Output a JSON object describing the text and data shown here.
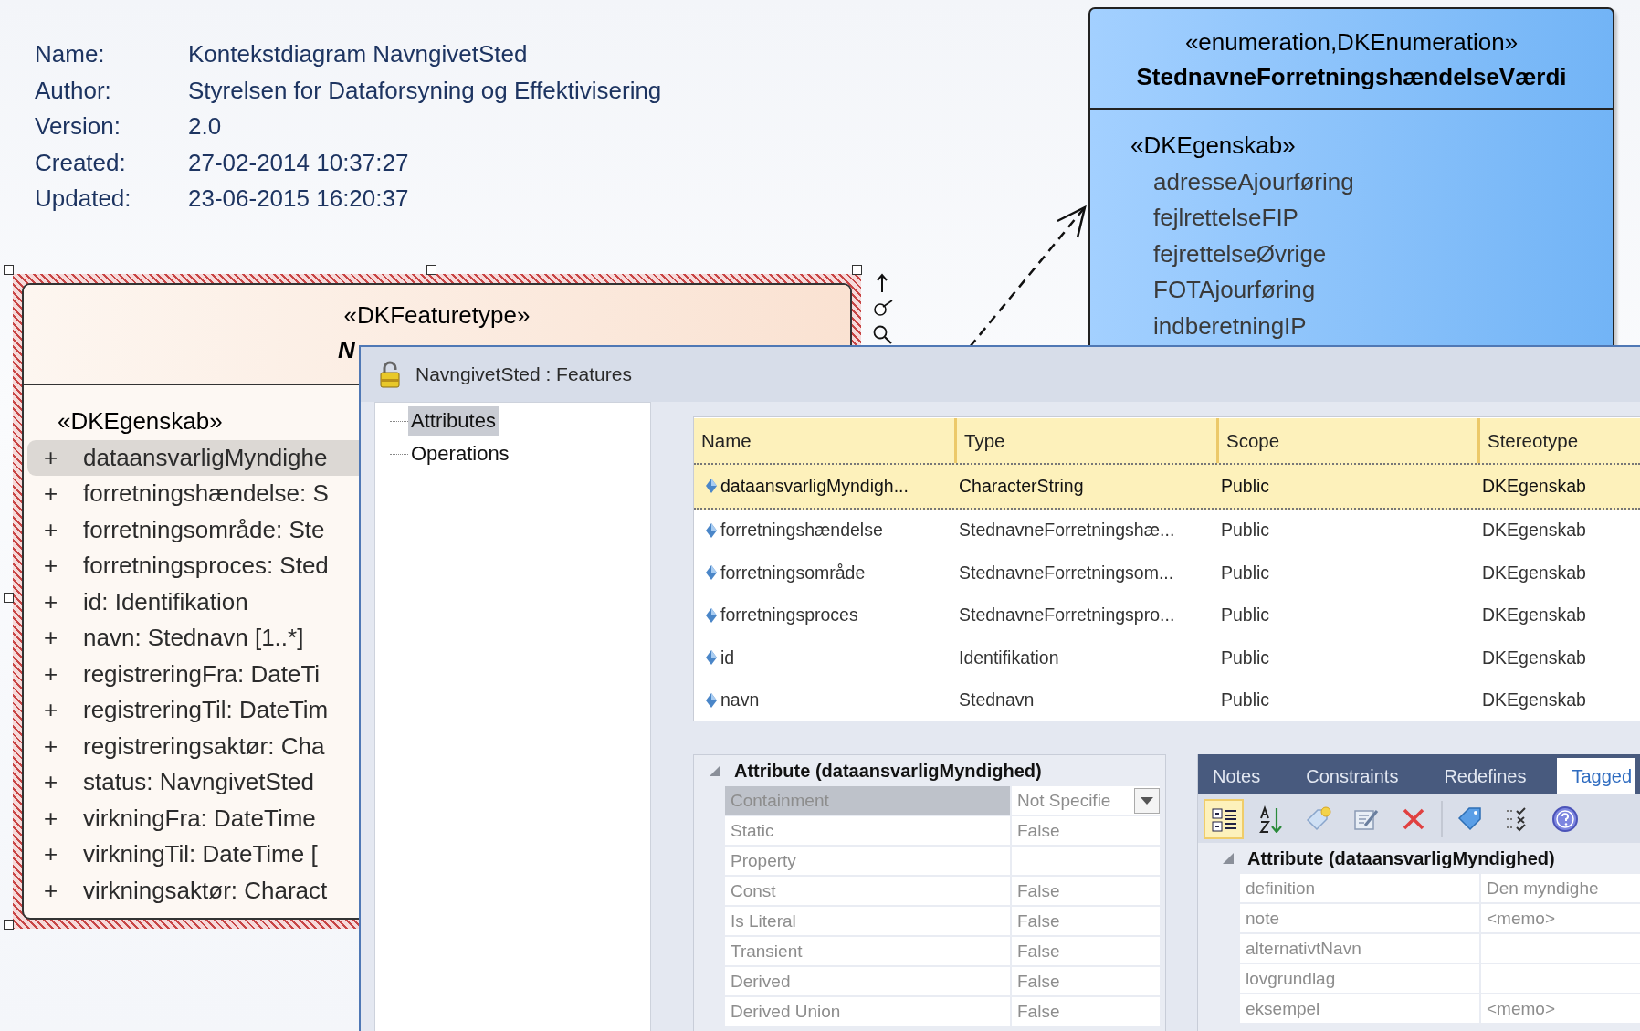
{
  "diagram_info": [
    {
      "label": "Name:",
      "value": "Kontekstdiagram NavngivetSted"
    },
    {
      "label": "Author:",
      "value": "Styrelsen for Dataforsyning og Effektivisering"
    },
    {
      "label": "Version:",
      "value": "2.0"
    },
    {
      "label": "Created:",
      "value": "27-02-2014 10:37:27"
    },
    {
      "label": "Updated:",
      "value": "23-06-2015 16:20:37"
    }
  ],
  "enum_class": {
    "stereotype": "«enumeration,DKEnumeration»",
    "name": "StednavneForretningshændelseVærdi",
    "section_stereotype": "«DKEgenskab»",
    "literals": [
      "adresseAjourføring",
      "fejlrettelseFIP",
      "fejrettelseØvrige",
      "FOTAjourføring",
      "indberetningIP"
    ]
  },
  "feature_class": {
    "selected": true,
    "stereotype": "«DKFeaturetype»",
    "name": "N",
    "section_stereotype": "«DKEgenskab»",
    "attributes": [
      {
        "visibility": "+",
        "text": "dataansvarligMyndighe",
        "selected": true
      },
      {
        "visibility": "+",
        "text": "forretningshændelse: S",
        "selected": false
      },
      {
        "visibility": "+",
        "text": "forretningsområde: Ste",
        "selected": false
      },
      {
        "visibility": "+",
        "text": "forretningsproces: Sted",
        "selected": false
      },
      {
        "visibility": "+",
        "text": "id: Identifikation",
        "selected": false
      },
      {
        "visibility": "+",
        "text": "navn: Stednavn [1..*]",
        "selected": false
      },
      {
        "visibility": "+",
        "text": "registreringFra: DateTi",
        "selected": false
      },
      {
        "visibility": "+",
        "text": "registreringTil: DateTim",
        "selected": false
      },
      {
        "visibility": "+",
        "text": "registreringsaktør: Cha",
        "selected": false
      },
      {
        "visibility": "+",
        "text": "status: NavngivetSted",
        "selected": false
      },
      {
        "visibility": "+",
        "text": "virkningFra: DateTime",
        "selected": false
      },
      {
        "visibility": "+",
        "text": "virkningTil: DateTime [",
        "selected": false
      },
      {
        "visibility": "+",
        "text": "virkningsaktør: Charact",
        "selected": false
      }
    ]
  },
  "dialog": {
    "title": "NavngivetSted : Features",
    "tree": [
      {
        "label": "Attributes",
        "selected": true
      },
      {
        "label": "Operations",
        "selected": false
      }
    ],
    "table": {
      "columns": [
        "Name",
        "Type",
        "Scope",
        "Stereotype"
      ],
      "rows": [
        {
          "cells": [
            "dataansvarligMyndigh...",
            "CharacterString",
            "Public",
            "DKEgenskab"
          ],
          "selected": true
        },
        {
          "cells": [
            "forretningshændelse",
            "StednavneForretningshæ...",
            "Public",
            "DKEgenskab"
          ],
          "selected": false
        },
        {
          "cells": [
            "forretningsområde",
            "StednavneForretningsom...",
            "Public",
            "DKEgenskab"
          ],
          "selected": false
        },
        {
          "cells": [
            "forretningsproces",
            "StednavneForretningspro...",
            "Public",
            "DKEgenskab"
          ],
          "selected": false
        },
        {
          "cells": [
            "id",
            "Identifikation",
            "Public",
            "DKEgenskab"
          ],
          "selected": false
        },
        {
          "cells": [
            "navn",
            "Stednavn",
            "Public",
            "DKEgenskab"
          ],
          "selected": false
        }
      ]
    },
    "attribute_grid": {
      "title": "Attribute (dataansvarligMyndighed)",
      "expanded": true,
      "rows": [
        {
          "name": "Containment",
          "value": "Not Specifie",
          "kind": "dropdown",
          "selected": true
        },
        {
          "name": "Static",
          "value": "False",
          "kind": "text",
          "selected": false
        },
        {
          "name": "Property",
          "kind": "text",
          "selected": false
        },
        {
          "name": "Const",
          "value": "False",
          "kind": "text",
          "selected": false
        },
        {
          "name": "Is Literal",
          "value": "False",
          "kind": "text",
          "selected": false
        },
        {
          "name": "Transient",
          "value": "False",
          "kind": "text",
          "selected": false
        },
        {
          "name": "Derived",
          "value": "False",
          "kind": "text",
          "selected": false
        },
        {
          "name": "Derived Union",
          "value": "False",
          "kind": "text",
          "selected": false
        }
      ]
    },
    "detail_tabs": [
      {
        "label": "Notes",
        "selected": false
      },
      {
        "label": "Constraints",
        "selected": false
      },
      {
        "label": "Redefines",
        "selected": false
      },
      {
        "label": "Tagged",
        "selected": true
      }
    ],
    "toolbar": [
      {
        "kind": "categorized",
        "pressed": true
      },
      {
        "kind": "sort",
        "pressed": false
      },
      {
        "kind": "new-tag",
        "pressed": false
      },
      {
        "kind": "edit",
        "pressed": false
      },
      {
        "kind": "delete",
        "pressed": false
      },
      {
        "kind": "separator"
      },
      {
        "kind": "tag-stack",
        "pressed": false
      },
      {
        "kind": "checklist",
        "pressed": false
      },
      {
        "kind": "help",
        "pressed": false
      }
    ],
    "tagged_grid": {
      "title": "Attribute (dataansvarligMyndighed)",
      "expanded": true,
      "rows": [
        {
          "name": "definition",
          "value": "Den myndighe"
        },
        {
          "name": "note",
          "value": "<memo>"
        },
        {
          "name": "alternativtNavn"
        },
        {
          "name": "lovgrundlag"
        },
        {
          "name": "eksempel",
          "value": "<memo>"
        }
      ]
    }
  }
}
